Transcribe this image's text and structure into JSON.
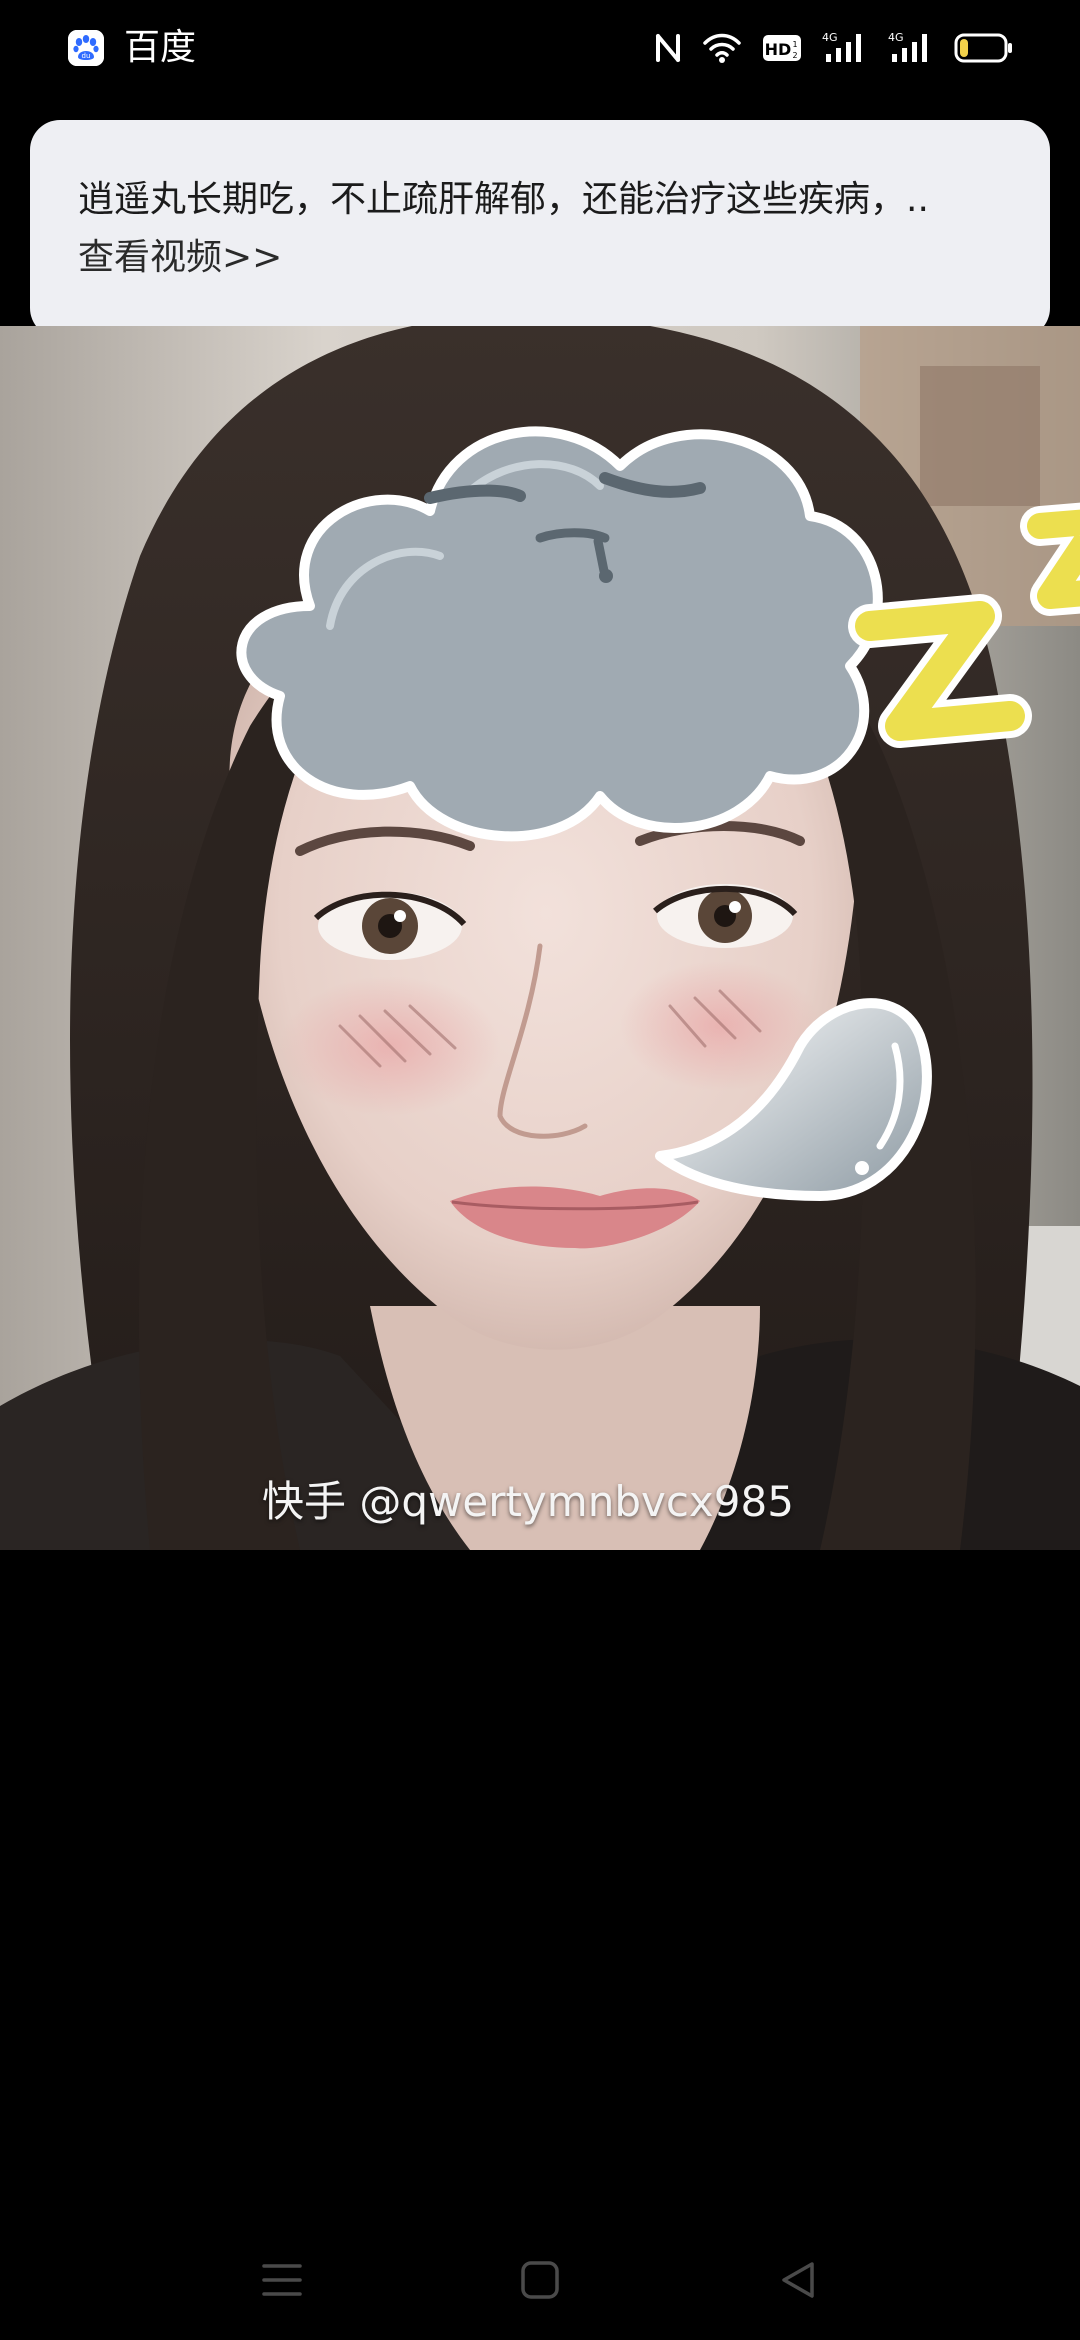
{
  "status_bar": {
    "app_name": "百度",
    "app_icon": "baidu-paw-icon",
    "icons": [
      "nfc-icon",
      "wifi-icon",
      "hd-voice-icon",
      "signal-4g-icon",
      "signal-4g-icon",
      "battery-icon"
    ],
    "hd_label": "HD",
    "network_label": "4G",
    "battery_level": 0.15,
    "colors": {
      "battery_fill": "#f2d14a",
      "app_icon_accent": "#2f6bff"
    }
  },
  "notification": {
    "title": "逍遥丸长期吃，不止疏肝解郁，还能治疗这些疾病，..",
    "link": "查看视频>>"
  },
  "video": {
    "watermark": "快手 @qwertymnbvcx985",
    "stickers": [
      "sleepy-cloud-sticker",
      "zz-sleep-sticker",
      "snot-bubble-sticker"
    ]
  },
  "nav_bar": {
    "buttons": [
      "menu-icon",
      "home-icon",
      "back-icon"
    ]
  }
}
